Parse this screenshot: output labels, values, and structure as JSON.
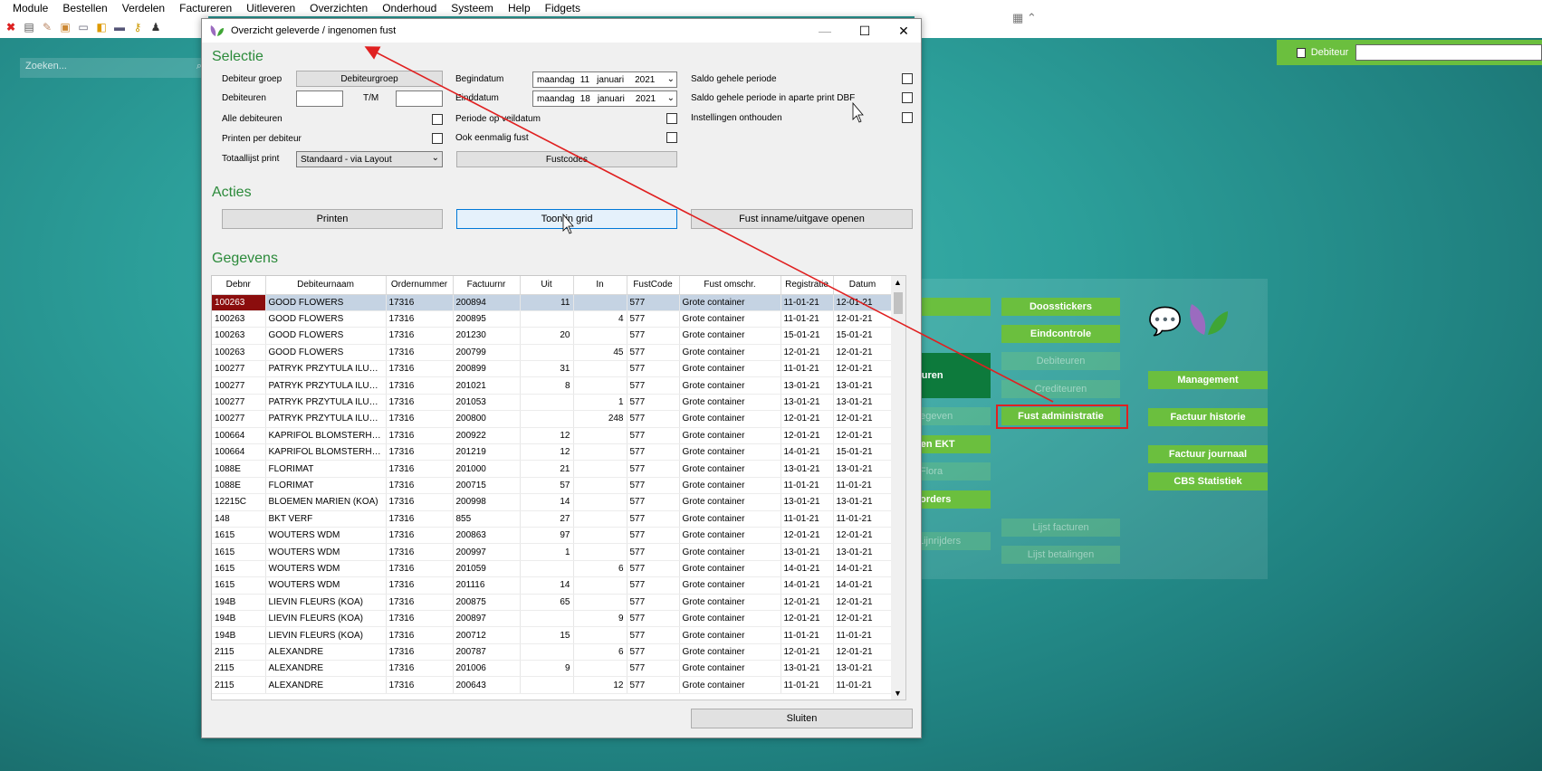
{
  "menu": [
    "Module",
    "Bestellen",
    "Verdelen",
    "Factureren",
    "Uitleveren",
    "Overzichten",
    "Onderhoud",
    "Systeem",
    "Help",
    "Fidgets"
  ],
  "toolbar_icons": [
    "close-icon",
    "report-icon",
    "edit-doc-icon",
    "box-icon",
    "message-icon",
    "package-icon",
    "card-icon",
    "key-icon",
    "user-icon"
  ],
  "background": {
    "search_placeholder": "Zoeken...",
    "debiteur_label": "Debiteur",
    "buttons": {
      "doosstickers": "Doosstickers",
      "eindcontrole": "Eindcontrole",
      "debiteuren": "Debiteuren",
      "crediteuren": "Crediteuren",
      "fust_administratie": "Fust administratie",
      "management": "Management",
      "factuur_historie": "Factuur historie",
      "factuur_journaal": "Factuur journaal",
      "cbs_statistiek": "CBS Statistiek",
      "lijst_facturen": "Lijst facturen",
      "lijst_betalingen": "Lijst betalingen",
      "facturen_partial": "cturen",
      "gegevens_partial": "gegeven",
      "den_ekt_partial": "den EKT",
      "flora_partial": "Flora",
      "korders_partial": "korders",
      "lijnrijders_partial": "Lijnrijders"
    }
  },
  "dialog": {
    "title": "Overzicht geleverde / ingenomen fust",
    "selectie": {
      "heading": "Selectie",
      "debiteur_groep_label": "Debiteur groep",
      "debiteur_groep_button": "Debiteurgroep",
      "debiteuren_label": "Debiteuren",
      "tm_label": "T/M",
      "alle_debiteuren_label": "Alle debiteuren",
      "printen_per_debiteur_label": "Printen per debiteur",
      "totaallijst_print_label": "Totaallijst print",
      "totaallijst_value": "Standaard - via Layout",
      "begindatum_label": "Begindatum",
      "begindatum": {
        "day_name": "maandag",
        "day": "11",
        "month": "januari",
        "year": "2021"
      },
      "einddatum_label": "Einddatum",
      "einddatum": {
        "day_name": "maandag",
        "day": "18",
        "month": "januari",
        "year": "2021"
      },
      "periode_veildatum_label": "Periode op veildatum",
      "ook_eenmalig_fust_label": "Ook eenmalig fust",
      "fustcodes_button": "Fustcodes",
      "saldo_periode_label": "Saldo gehele periode",
      "saldo_aparte_label": "Saldo gehele periode in aparte print DBF",
      "instellingen_label": "Instellingen onthouden"
    },
    "acties": {
      "heading": "Acties",
      "printen": "Printen",
      "toon_in_grid": "Toon in grid",
      "fust_openen": "Fust inname/uitgave openen"
    },
    "gegevens": {
      "heading": "Gegevens",
      "columns": [
        "Debnr",
        "Debiteurnaam",
        "Ordernummer",
        "Factuurnr",
        "Uit",
        "In",
        "FustCode",
        "Fust omschr.",
        "Registratie",
        "Datum"
      ],
      "rows": [
        [
          "100263",
          "GOOD FLOWERS",
          "17316",
          "200894",
          "11",
          "",
          "577",
          "Grote container",
          "11-01-21",
          "12-01-21"
        ],
        [
          "100263",
          "GOOD FLOWERS",
          "17316",
          "200895",
          "",
          "4",
          "577",
          "Grote container",
          "11-01-21",
          "12-01-21"
        ],
        [
          "100263",
          "GOOD FLOWERS",
          "17316",
          "201230",
          "20",
          "",
          "577",
          "Grote container",
          "15-01-21",
          "15-01-21"
        ],
        [
          "100263",
          "GOOD FLOWERS",
          "17316",
          "200799",
          "",
          "45",
          "577",
          "Grote container",
          "12-01-21",
          "12-01-21"
        ],
        [
          "100277",
          "PATRYK PRZYTULA ILUZJA",
          "17316",
          "200899",
          "31",
          "",
          "577",
          "Grote container",
          "11-01-21",
          "12-01-21"
        ],
        [
          "100277",
          "PATRYK PRZYTULA ILUZJA",
          "17316",
          "201021",
          "8",
          "",
          "577",
          "Grote container",
          "13-01-21",
          "13-01-21"
        ],
        [
          "100277",
          "PATRYK PRZYTULA ILUZJA",
          "17316",
          "201053",
          "",
          "1",
          "577",
          "Grote container",
          "13-01-21",
          "13-01-21"
        ],
        [
          "100277",
          "PATRYK PRZYTULA ILUZJA",
          "17316",
          "200800",
          "",
          "248",
          "577",
          "Grote container",
          "12-01-21",
          "12-01-21"
        ],
        [
          "100664",
          "KAPRIFOL BLOMSTERHANDEL",
          "17316",
          "200922",
          "12",
          "",
          "577",
          "Grote container",
          "12-01-21",
          "12-01-21"
        ],
        [
          "100664",
          "KAPRIFOL BLOMSTERHANDEL",
          "17316",
          "201219",
          "12",
          "",
          "577",
          "Grote container",
          "14-01-21",
          "15-01-21"
        ],
        [
          "1088E",
          "FLORIMAT",
          "17316",
          "201000",
          "21",
          "",
          "577",
          "Grote container",
          "13-01-21",
          "13-01-21"
        ],
        [
          "1088E",
          "FLORIMAT",
          "17316",
          "200715",
          "57",
          "",
          "577",
          "Grote container",
          "11-01-21",
          "11-01-21"
        ],
        [
          "12215C",
          "BLOEMEN MARIEN (KOA)",
          "17316",
          "200998",
          "14",
          "",
          "577",
          "Grote container",
          "13-01-21",
          "13-01-21"
        ],
        [
          "148",
          "BKT VERF",
          "17316",
          "855",
          "27",
          "",
          "577",
          "Grote container",
          "11-01-21",
          "11-01-21"
        ],
        [
          "1615",
          "WOUTERS WDM",
          "17316",
          "200863",
          "97",
          "",
          "577",
          "Grote container",
          "12-01-21",
          "12-01-21"
        ],
        [
          "1615",
          "WOUTERS WDM",
          "17316",
          "200997",
          "1",
          "",
          "577",
          "Grote container",
          "13-01-21",
          "13-01-21"
        ],
        [
          "1615",
          "WOUTERS WDM",
          "17316",
          "201059",
          "",
          "6",
          "577",
          "Grote container",
          "14-01-21",
          "14-01-21"
        ],
        [
          "1615",
          "WOUTERS WDM",
          "17316",
          "201116",
          "14",
          "",
          "577",
          "Grote container",
          "14-01-21",
          "14-01-21"
        ],
        [
          "194B",
          "LIEVIN FLEURS (KOA)",
          "17316",
          "200875",
          "65",
          "",
          "577",
          "Grote container",
          "12-01-21",
          "12-01-21"
        ],
        [
          "194B",
          "LIEVIN FLEURS (KOA)",
          "17316",
          "200897",
          "",
          "9",
          "577",
          "Grote container",
          "12-01-21",
          "12-01-21"
        ],
        [
          "194B",
          "LIEVIN FLEURS (KOA)",
          "17316",
          "200712",
          "15",
          "",
          "577",
          "Grote container",
          "11-01-21",
          "11-01-21"
        ],
        [
          "2115",
          "ALEXANDRE",
          "17316",
          "200787",
          "",
          "6",
          "577",
          "Grote container",
          "12-01-21",
          "12-01-21"
        ],
        [
          "2115",
          "ALEXANDRE",
          "17316",
          "201006",
          "9",
          "",
          "577",
          "Grote container",
          "13-01-21",
          "13-01-21"
        ],
        [
          "2115",
          "ALEXANDRE",
          "17316",
          "200643",
          "",
          "12",
          "577",
          "Grote container",
          "11-01-21",
          "11-01-21"
        ]
      ]
    },
    "sluiten": "Sluiten"
  },
  "colors": {
    "accent_green": "#6bbf3e",
    "section_green": "#2b8a3a",
    "annotation_red": "#e02020",
    "selected_cell": "#8b0d0d"
  }
}
